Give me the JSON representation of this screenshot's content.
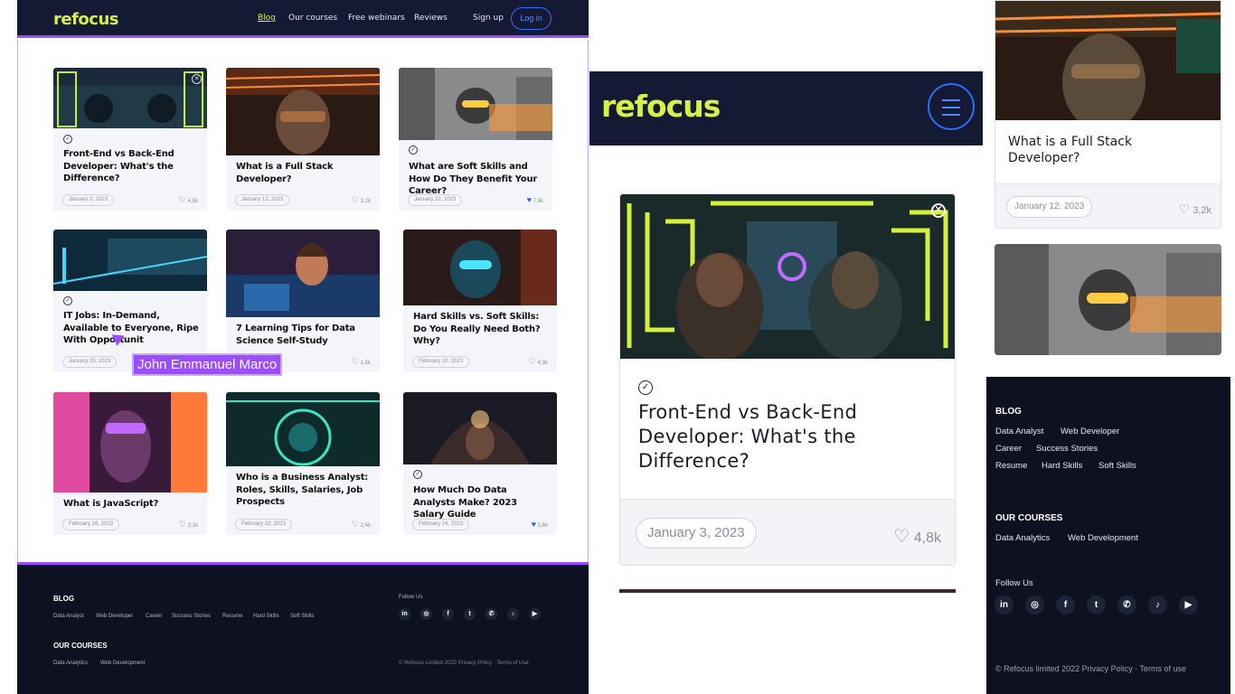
{
  "desktop": {
    "logo": "refocus",
    "nav": [
      "Blog",
      "Our courses",
      "Free webinars",
      "Reviews"
    ],
    "signup": "Sign up",
    "login": "Log in",
    "cards": [
      {
        "title": "Front-End vs Back-End Developer: What's the Difference?",
        "date": "January 3, 2023",
        "likes": "4,8k"
      },
      {
        "title": "What is a Full Stack Developer?",
        "date": "January 12, 2023",
        "likes": "3,2k"
      },
      {
        "title": "What are Soft Skills and How Do They Benefit Your Career?",
        "date": "January 22, 2023",
        "likes": "7,8k"
      },
      {
        "title": "IT Jobs: In-Demand, Available to Everyone, Ripe With Opportunit",
        "date": "January 25, 2023",
        "likes": ""
      },
      {
        "title": "7 Learning Tips for Data Science Self-Study",
        "date": "",
        "likes": "1,5k"
      },
      {
        "title": "Hard Skills vs. Soft Skills: Do You Really Need Both? Why?",
        "date": "February 10, 2023",
        "likes": "4,9k"
      },
      {
        "title": "What is JavaScript?",
        "date": "February 16, 2023",
        "likes": "3,1k"
      },
      {
        "title": "Who is a Business Analyst: Roles, Skills, Salaries, Job Prospects",
        "date": "February 22, 2023",
        "likes": "2,4k"
      },
      {
        "title": "How Much Do Data Analysts Make? 2023 Salary Guide",
        "date": "February 24, 2023",
        "likes": "3,6k"
      }
    ],
    "tooltip": "John Emmanuel Marco",
    "footer": {
      "blog_heading": "BLOG",
      "blog_links": [
        "Data Analyst",
        "Web Developer",
        "Career",
        "Success Stories",
        "Resume",
        "Hard Skills",
        "Soft Skills"
      ],
      "courses_heading": "OUR COURSES",
      "course_links": [
        "Data Analytics",
        "Web Development"
      ],
      "follow": "Follow Us",
      "social": [
        "in",
        "◎",
        "f",
        "t",
        "✆",
        "♪",
        "▶"
      ],
      "copyright": "© Refocus Limited 2022   Privacy Policy  ·  Terms of Use"
    }
  },
  "mobile": {
    "logo": "refocus",
    "card": {
      "title": "Front-End vs Back-End Developer: What's the Difference?",
      "date": "January 3, 2023",
      "likes": "4,8k"
    }
  },
  "mobile_right": {
    "card": {
      "title": "What is a Full Stack Developer?",
      "date": "January 12, 2023",
      "likes": "3,2k"
    },
    "footer": {
      "blog_heading": "BLOG",
      "blog_rows": [
        [
          "Data Analyst",
          "Web Developer"
        ],
        [
          "Career",
          "Success Stories"
        ],
        [
          "Resume",
          "Hard Skills",
          "Soft Skills"
        ]
      ],
      "courses_heading": "OUR COURSES",
      "course_links": [
        "Data Analytics",
        "Web Development"
      ],
      "follow": "Follow Us",
      "social": [
        "in",
        "◎",
        "f",
        "t",
        "✆",
        "♪",
        "▶"
      ],
      "copyright": "© Refocus limited 2022 Privacy Policy · Terms of use"
    }
  }
}
